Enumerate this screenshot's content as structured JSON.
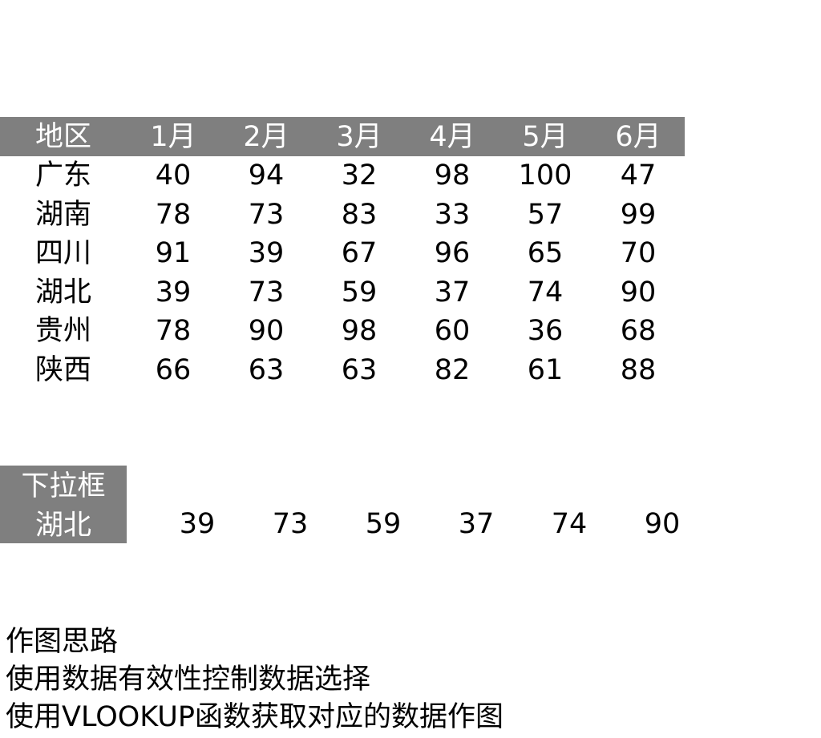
{
  "table": {
    "header": [
      "地区",
      "1月",
      "2月",
      "3月",
      "4月",
      "5月",
      "6月"
    ],
    "rows": [
      [
        "广东",
        "40",
        "94",
        "32",
        "98",
        "100",
        "47"
      ],
      [
        "湖南",
        "78",
        "73",
        "83",
        "33",
        "57",
        "99"
      ],
      [
        "四川",
        "91",
        "39",
        "67",
        "96",
        "65",
        "70"
      ],
      [
        "湖北",
        "39",
        "73",
        "59",
        "37",
        "74",
        "90"
      ],
      [
        "贵州",
        "78",
        "90",
        "98",
        "60",
        "36",
        "68"
      ],
      [
        "陕西",
        "66",
        "63",
        "63",
        "82",
        "61",
        "88"
      ]
    ]
  },
  "dropdown": {
    "label": "下拉框",
    "selected": "湖北",
    "values": [
      "39",
      "73",
      "59",
      "37",
      "74",
      "90"
    ]
  },
  "notes": {
    "title": "作图思路",
    "line1": "使用数据有效性控制数据选择",
    "line2": "使用VLOOKUP函数获取对应的数据作图"
  },
  "colors": {
    "header_fill": "#7f7f7f",
    "header_text": "#ffffff"
  }
}
